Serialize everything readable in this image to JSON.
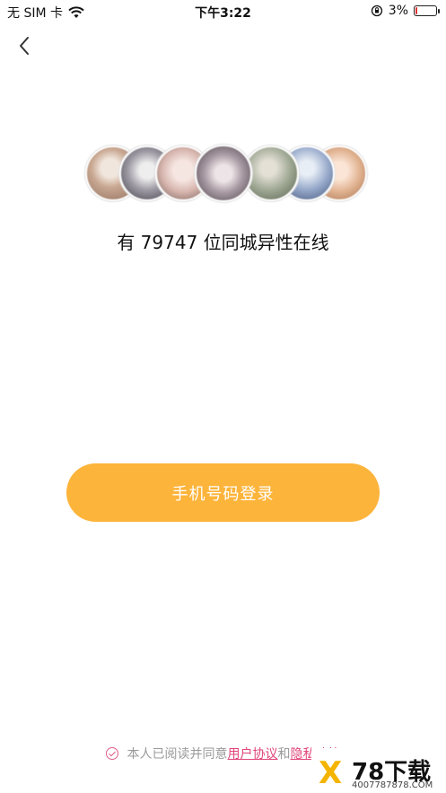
{
  "status_bar": {
    "carrier": "无 SIM 卡",
    "time": "下午3:22",
    "battery_percent": "3%",
    "battery_level": 0.03,
    "icons": [
      "wifi-icon",
      "orientation-lock-icon",
      "battery-icon"
    ]
  },
  "nav": {
    "back_icon": "chevron-left-icon"
  },
  "hero": {
    "online_text": "有 79747 位同城异性在线",
    "avatar_count": 7
  },
  "actions": {
    "phone_login_label": "手机号码登录"
  },
  "agreement": {
    "prefix": "本人已阅读并同意",
    "user_agreement": "用户协议",
    "connector": "和",
    "privacy_policy": "隐私政策"
  },
  "watermark": {
    "brand": "78下载",
    "domain": "4007787878.COM"
  },
  "colors": {
    "primary_button": "#fdb43b",
    "link": "#e0457a",
    "text": "#111111",
    "muted": "#9a9a9a"
  }
}
